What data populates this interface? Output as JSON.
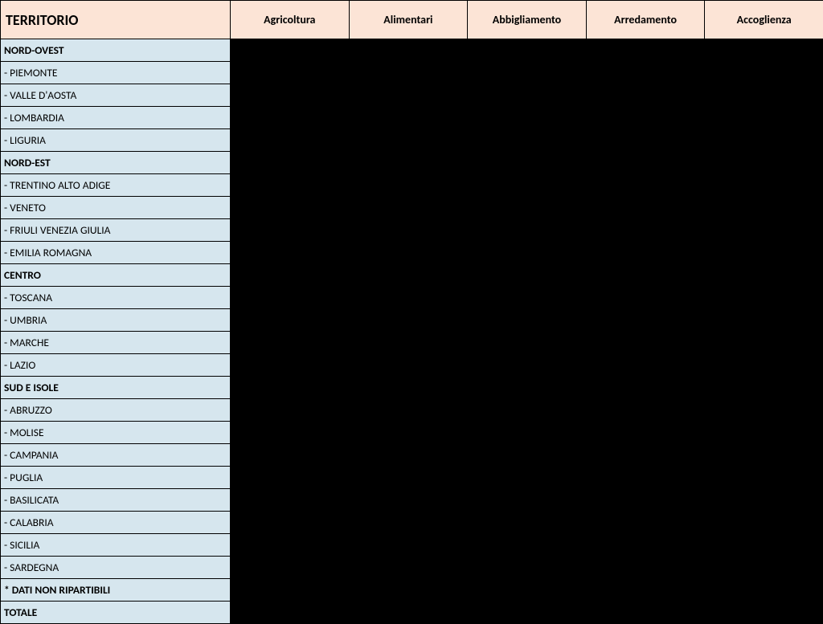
{
  "headers": {
    "territory": "TERRITORIO",
    "col1": "Agricoltura",
    "col2": "Alimentari",
    "col3": "Abbigliamento",
    "col4": "Arredamento",
    "col5": "Accoglienza"
  },
  "rows": [
    {
      "label": "NORD-OVEST",
      "bold": true
    },
    {
      "label": "- PIEMONTE",
      "bold": false
    },
    {
      "label": "- VALLE D'AOSTA",
      "bold": false
    },
    {
      "label": "- LOMBARDIA",
      "bold": false
    },
    {
      "label": "- LIGURIA",
      "bold": false
    },
    {
      "label": "NORD-EST",
      "bold": true
    },
    {
      "label": "- TRENTINO ALTO ADIGE",
      "bold": false
    },
    {
      "label": "- VENETO",
      "bold": false
    },
    {
      "label": "- FRIULI VENEZIA GIULIA",
      "bold": false
    },
    {
      "label": "- EMILIA ROMAGNA",
      "bold": false
    },
    {
      "label": "CENTRO",
      "bold": true
    },
    {
      "label": "- TOSCANA",
      "bold": false
    },
    {
      "label": "- UMBRIA",
      "bold": false
    },
    {
      "label": "- MARCHE",
      "bold": false
    },
    {
      "label": "- LAZIO",
      "bold": false
    },
    {
      "label": "SUD E ISOLE",
      "bold": true
    },
    {
      "label": "- ABRUZZO",
      "bold": false
    },
    {
      "label": "- MOLISE",
      "bold": false
    },
    {
      "label": "- CAMPANIA",
      "bold": false
    },
    {
      "label": "- PUGLIA",
      "bold": false
    },
    {
      "label": "- BASILICATA",
      "bold": false
    },
    {
      "label": "- CALABRIA",
      "bold": false
    },
    {
      "label": "- SICILIA",
      "bold": false
    },
    {
      "label": "- SARDEGNA",
      "bold": false
    },
    {
      "label": "* DATI NON RIPARTIBILI",
      "bold": true
    },
    {
      "label": "TOTALE",
      "bold": true
    }
  ]
}
